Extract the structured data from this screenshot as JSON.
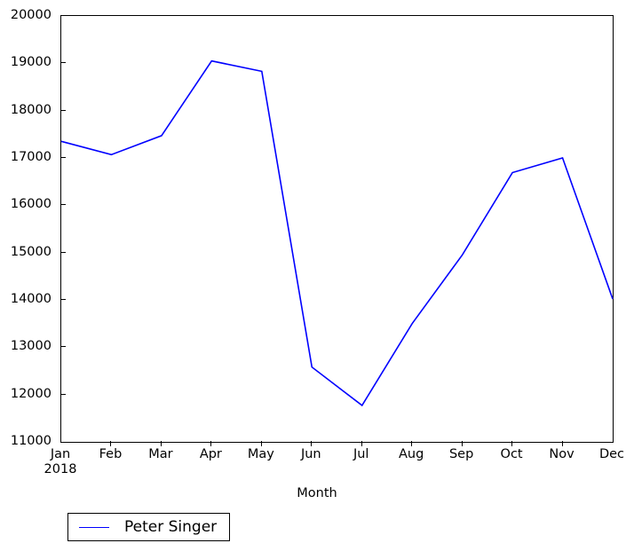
{
  "chart_data": {
    "type": "line",
    "title": "",
    "subtitle": "",
    "xlabel": "Month",
    "ylabel": "",
    "categories": [
      "Jan",
      "Feb",
      "Mar",
      "Apr",
      "May",
      "Jun",
      "Jul",
      "Aug",
      "Sep",
      "Oct",
      "Nov",
      "Dec"
    ],
    "x_sublabels": [
      "2018",
      "",
      "",
      "",
      "",
      "",
      "",
      "",
      "",
      "",
      "",
      ""
    ],
    "series": [
      {
        "name": "Peter Singer",
        "color": "#0000ff",
        "values": [
          17350,
          17070,
          17470,
          19050,
          18830,
          12580,
          11770,
          13500,
          14950,
          16690,
          17000,
          14020
        ]
      }
    ],
    "ylim": [
      11000,
      20000
    ],
    "y_ticks": [
      11000,
      12000,
      13000,
      14000,
      15000,
      16000,
      17000,
      18000,
      19000,
      20000
    ],
    "y_tick_labels": [
      "11000",
      "12000",
      "13000",
      "14000",
      "15000",
      "16000",
      "17000",
      "18000",
      "19000",
      "20000"
    ],
    "xlim": [
      0,
      11
    ],
    "grid": false,
    "legend_position": "below-left",
    "markers": false,
    "line_width": 1.6
  },
  "legend": {
    "entries": [
      {
        "label": "Peter Singer",
        "color": "#0000ff"
      }
    ]
  },
  "axes": {
    "x_axis_label": "Month",
    "y_axis_label": ""
  },
  "colors": {
    "series_blue": "#0000ff",
    "axis": "#000000",
    "background": "#ffffff"
  }
}
